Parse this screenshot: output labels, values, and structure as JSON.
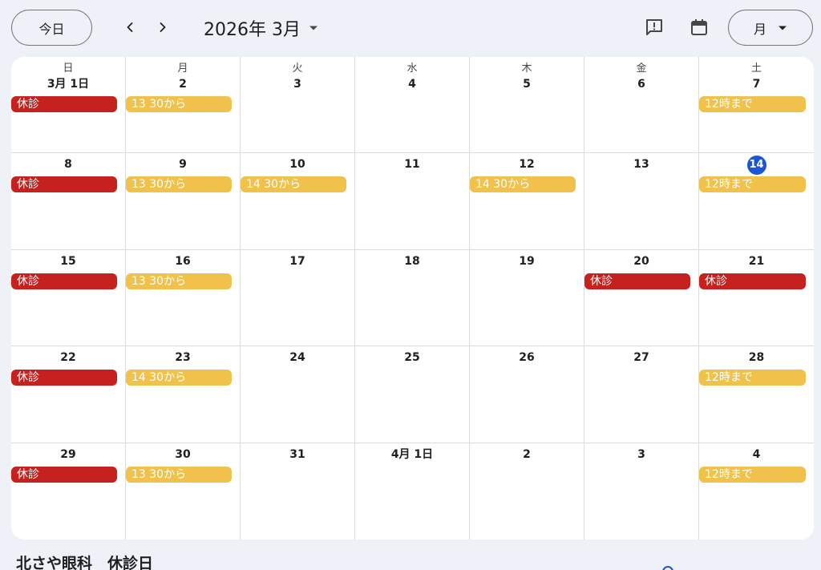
{
  "toolbar": {
    "today_label": "今日",
    "month_title": "2026年 3月",
    "view_label": "月",
    "icons": [
      "chevron-left-icon",
      "chevron-right-icon",
      "caret-down-icon",
      "feedback-icon",
      "calendar-icon"
    ]
  },
  "weekdays": [
    "日",
    "月",
    "火",
    "水",
    "木",
    "金",
    "土"
  ],
  "today_day": "14",
  "colors": {
    "closed": "#c5221f",
    "partial": "#f0c24b",
    "today": "#1a56d6"
  },
  "weeks": [
    [
      {
        "day": "3月 1日",
        "event": {
          "label": "休診",
          "kind": "closed"
        }
      },
      {
        "day": "2",
        "event": {
          "label": "13 30から",
          "kind": "partial"
        }
      },
      {
        "day": "3",
        "event": null
      },
      {
        "day": "4",
        "event": null
      },
      {
        "day": "5",
        "event": null
      },
      {
        "day": "6",
        "event": null
      },
      {
        "day": "7",
        "event": {
          "label": "12時まで",
          "kind": "partial"
        }
      }
    ],
    [
      {
        "day": "8",
        "event": {
          "label": "休診",
          "kind": "closed"
        }
      },
      {
        "day": "9",
        "event": {
          "label": "13 30から",
          "kind": "partial"
        }
      },
      {
        "day": "10",
        "event": {
          "label": "14 30から",
          "kind": "partial"
        }
      },
      {
        "day": "11",
        "event": null
      },
      {
        "day": "12",
        "event": {
          "label": "14 30から",
          "kind": "partial"
        }
      },
      {
        "day": "13",
        "event": null
      },
      {
        "day": "14",
        "event": {
          "label": "12時まで",
          "kind": "partial"
        }
      }
    ],
    [
      {
        "day": "15",
        "event": {
          "label": "休診",
          "kind": "closed"
        }
      },
      {
        "day": "16",
        "event": {
          "label": "13 30から",
          "kind": "partial"
        }
      },
      {
        "day": "17",
        "event": null
      },
      {
        "day": "18",
        "event": null
      },
      {
        "day": "19",
        "event": null
      },
      {
        "day": "20",
        "event": {
          "label": "休診",
          "kind": "closed"
        }
      },
      {
        "day": "21",
        "event": {
          "label": "休診",
          "kind": "closed"
        }
      }
    ],
    [
      {
        "day": "22",
        "event": {
          "label": "休診",
          "kind": "closed"
        }
      },
      {
        "day": "23",
        "event": {
          "label": "14 30から",
          "kind": "partial"
        }
      },
      {
        "day": "24",
        "event": null
      },
      {
        "day": "25",
        "event": null
      },
      {
        "day": "26",
        "event": null
      },
      {
        "day": "27",
        "event": null
      },
      {
        "day": "28",
        "event": {
          "label": "12時まで",
          "kind": "partial"
        }
      }
    ],
    [
      {
        "day": "29",
        "event": {
          "label": "休診",
          "kind": "closed"
        }
      },
      {
        "day": "30",
        "event": {
          "label": "13 30から",
          "kind": "partial"
        }
      },
      {
        "day": "31",
        "event": null
      },
      {
        "day": "4月 1日",
        "event": null
      },
      {
        "day": "2",
        "event": null
      },
      {
        "day": "3",
        "event": null
      },
      {
        "day": "4",
        "event": {
          "label": "12時まで",
          "kind": "partial"
        }
      }
    ]
  ],
  "footer": {
    "title": "北さや眼科　休診日"
  }
}
